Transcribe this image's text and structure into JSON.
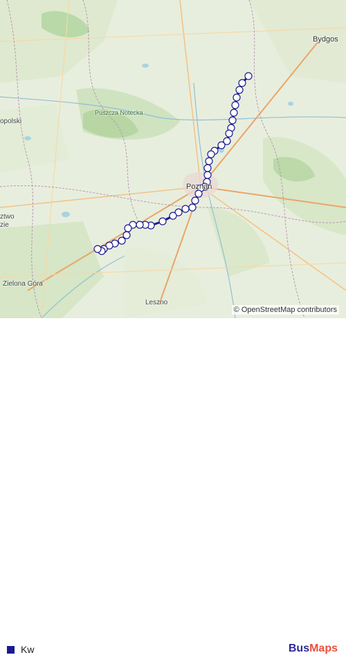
{
  "map": {
    "places": [
      {
        "id": "bydgoszcz",
        "label": "Bydgos"
      },
      {
        "id": "puszcza",
        "label": "Puszcza Notecka"
      },
      {
        "id": "poznan",
        "label": "Poznań"
      },
      {
        "id": "opolski",
        "label": "opolski"
      },
      {
        "id": "zielona-gora",
        "label": "Zielona Góra"
      },
      {
        "id": "leszno",
        "label": "Leszno"
      },
      {
        "id": "ztwo",
        "label": "ztwo"
      },
      {
        "id": "zie",
        "label": "zie"
      }
    ],
    "route_color": "#1a1a8f",
    "stop_fill": "#ffffff",
    "attribution": "© OpenStreetMap contributors"
  },
  "legend": {
    "label": "Kw",
    "color": "#1a1a8f"
  },
  "brand": {
    "part1": "Bus",
    "part2": "Maps"
  }
}
